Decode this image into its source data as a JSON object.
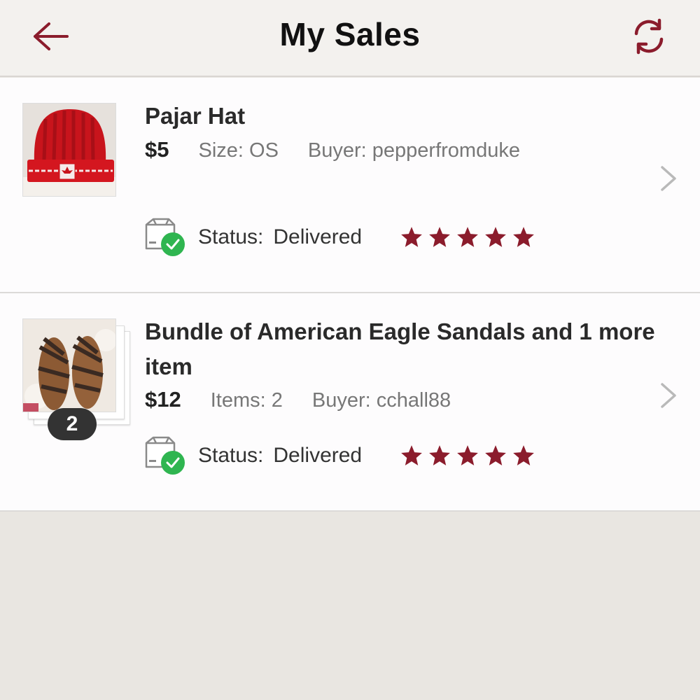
{
  "header": {
    "title": "My Sales",
    "back_icon": "arrow-left-icon",
    "refresh_icon": "refresh-icon"
  },
  "accent_color": "#8b1c2c",
  "sales": [
    {
      "title": "Pajar Hat",
      "price": "$5",
      "detail": "Size: OS",
      "buyer": "Buyer: pepperfromduke",
      "status_label": "Status:",
      "status_value": "Delivered",
      "rating": 5
    },
    {
      "title": "Bundle of American Eagle Sandals and 1 more item",
      "price": "$12",
      "detail": "Items: 2",
      "buyer": "Buyer: cchall88",
      "count_badge": "2",
      "status_label": "Status:",
      "status_value": "Delivered",
      "rating": 5
    }
  ]
}
